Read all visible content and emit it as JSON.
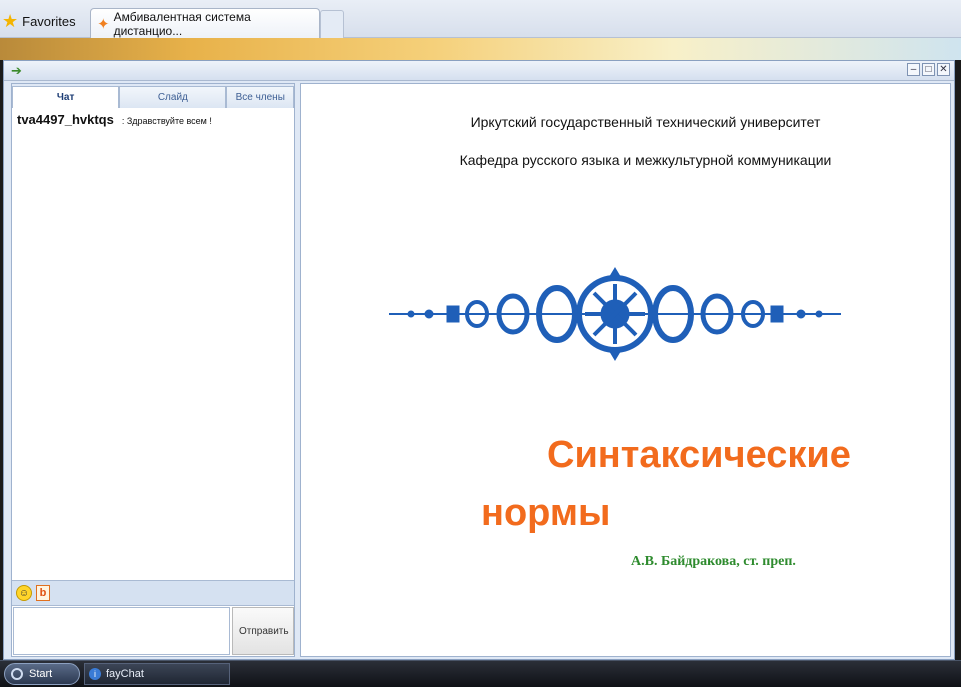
{
  "browser": {
    "favorites_label": "Favorites",
    "tab_title": "Амбивалентная система дистанцио..."
  },
  "chat_panel": {
    "tabs": [
      {
        "label": "Чат",
        "active": true
      },
      {
        "label": "Слайд",
        "active": false
      },
      {
        "label": "Все члены",
        "active": false
      }
    ],
    "messages": [
      {
        "user": "tva4497_hvktqs",
        "text": ": Здравствуйте всем !"
      }
    ],
    "input_value": "",
    "send_label": "Отправить"
  },
  "slide": {
    "line1": "Иркутский государственный технический университет",
    "line2": "Кафедра русского языка и межкультурной коммуникации",
    "title_part1": "Синтаксические",
    "title_part2": "нормы",
    "author": "А.В. Байдракова, ст. преп."
  },
  "colors": {
    "slide_title": "#f26b1d",
    "slide_author": "#2e8b2e",
    "ornament": "#1f5fb8"
  },
  "taskbar": {
    "start_label": "Start",
    "task_label": "fayChat"
  }
}
